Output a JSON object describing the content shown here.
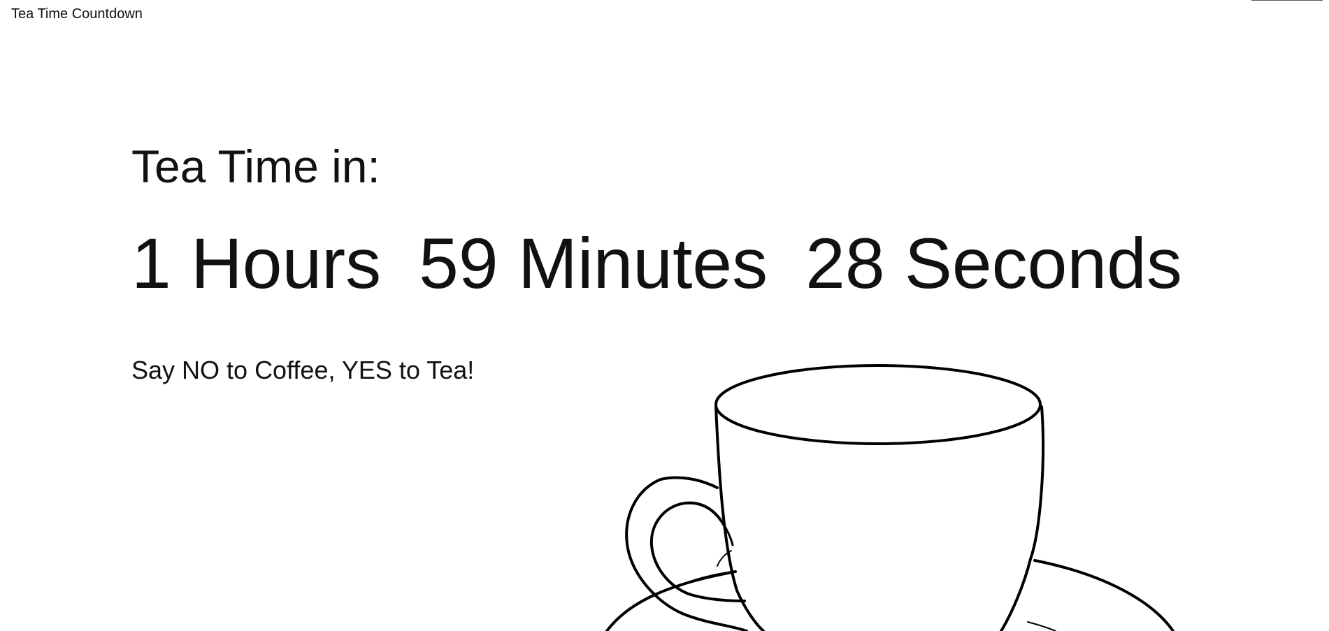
{
  "app": {
    "title": "Tea Time Countdown"
  },
  "main": {
    "heading": "Tea Time in:",
    "countdown": {
      "hours": "1 Hours",
      "minutes": "59 Minutes",
      "seconds": "28 Seconds"
    },
    "tagline": "Say NO to Coffee, YES to Tea!"
  },
  "icons": {
    "illustration": "teacup-icon"
  },
  "colors": {
    "background": "#ffffff",
    "text": "#111111",
    "line_art": "#000000"
  }
}
